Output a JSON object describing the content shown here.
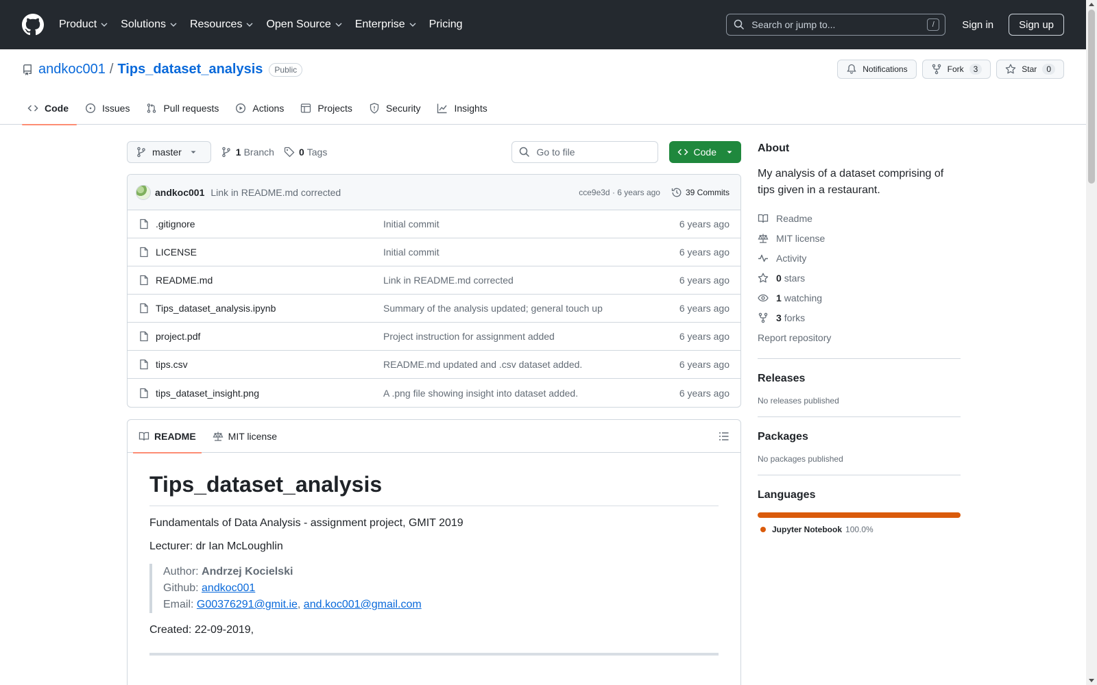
{
  "header": {
    "nav": [
      {
        "label": "Product",
        "dropdown": true
      },
      {
        "label": "Solutions",
        "dropdown": true
      },
      {
        "label": "Resources",
        "dropdown": true
      },
      {
        "label": "Open Source",
        "dropdown": true
      },
      {
        "label": "Enterprise",
        "dropdown": true
      },
      {
        "label": "Pricing",
        "dropdown": false
      }
    ],
    "search_placeholder": "Search or jump to...",
    "search_key": "/",
    "sign_in": "Sign in",
    "sign_up": "Sign up"
  },
  "repo": {
    "owner": "andkoc001",
    "separator": "/",
    "name": "Tips_dataset_analysis",
    "visibility": "Public",
    "notifications_label": "Notifications",
    "fork_label": "Fork",
    "fork_count": "3",
    "star_label": "Star",
    "star_count": "0",
    "tabs": [
      "Code",
      "Issues",
      "Pull requests",
      "Actions",
      "Projects",
      "Security",
      "Insights"
    ]
  },
  "toolbar": {
    "branch": "master",
    "branch_count": "1",
    "branch_label": "Branch",
    "tag_count": "0",
    "tag_label": "Tags",
    "goto_placeholder": "Go to file",
    "code_label": "Code"
  },
  "latest_commit": {
    "author": "andkoc001",
    "message": "Link in README.md corrected",
    "meta": "cce9e3d · 6 years ago",
    "commits_label": "39 Commits"
  },
  "files": [
    {
      "name": ".gitignore",
      "commit": "Initial commit",
      "age": "6 years ago"
    },
    {
      "name": "LICENSE",
      "commit": "Initial commit",
      "age": "6 years ago"
    },
    {
      "name": "README.md",
      "commit": "Link in README.md corrected",
      "age": "6 years ago"
    },
    {
      "name": "Tips_dataset_analysis.ipynb",
      "commit": "Summary of the analysis updated; general touch up",
      "age": "6 years ago"
    },
    {
      "name": "project.pdf",
      "commit": "Project instruction for assignment added",
      "age": "6 years ago"
    },
    {
      "name": "tips.csv",
      "commit": "README.md updated and .csv dataset added.",
      "age": "6 years ago"
    },
    {
      "name": "tips_dataset_insight.png",
      "commit": "A .png file showing insight into dataset added.",
      "age": "6 years ago"
    }
  ],
  "readme": {
    "tab_readme": "README",
    "tab_license": "MIT license",
    "title": "Tips_dataset_analysis",
    "line1": "Fundamentals of Data Analysis - assignment project, GMIT 2019",
    "line2": "Lecturer: dr Ian McLoughlin",
    "author_label": "Author: ",
    "author_name": "Andrzej Kocielski",
    "github_label": "Github: ",
    "github_link": "andkoc001",
    "email_label": "Email: ",
    "email1": "G00376291@gmit.ie",
    "email_sep": ", ",
    "email2": "and.koc001@gmail.com",
    "created": "Created: 22-09-2019,"
  },
  "sidebar": {
    "about_title": "About",
    "description": "My analysis of a dataset comprising of tips given in a restaurant.",
    "readme": "Readme",
    "license": "MIT license",
    "activity": "Activity",
    "stars_count": "0",
    "stars_label": "stars",
    "watching_count": "1",
    "watching_label": "watching",
    "forks_count": "3",
    "forks_label": "forks",
    "report": "Report repository",
    "releases_title": "Releases",
    "releases_text": "No releases published",
    "packages_title": "Packages",
    "packages_text": "No packages published",
    "languages_title": "Languages",
    "language_name": "Jupyter Notebook",
    "language_pct": "100.0%",
    "language_color": "#da5b0b"
  },
  "colors": {
    "header_bg": "#24292f",
    "link": "#0969da",
    "code_button": "#1f883d",
    "active_tab_underline": "#fd8c73"
  }
}
